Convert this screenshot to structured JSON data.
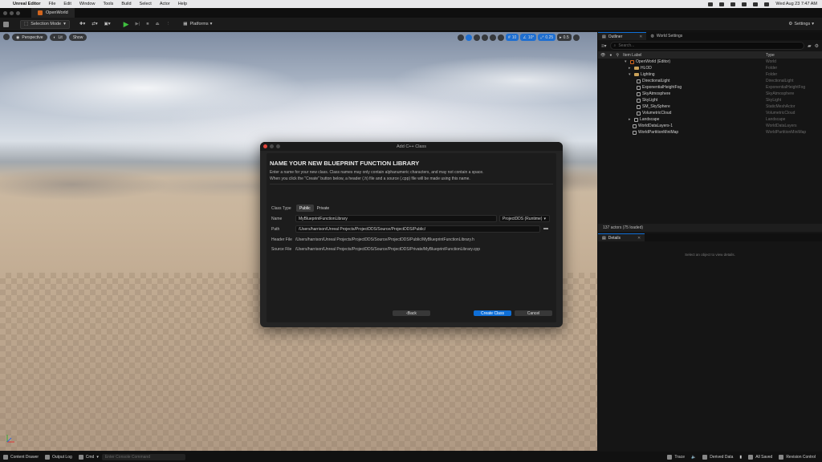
{
  "menubar": {
    "app": "Unreal Editor",
    "items": [
      "File",
      "Edit",
      "Window",
      "Tools",
      "Build",
      "Select",
      "Actor",
      "Help"
    ],
    "clock": "Wed Aug 23  7:47 AM"
  },
  "tab": {
    "title": "OpenWorld"
  },
  "toolbar": {
    "mode": "Selection Mode",
    "platforms": "Platforms",
    "settings": "Settings"
  },
  "viewport": {
    "perspective": "Perspective",
    "lit": "Lit",
    "show": "Show",
    "grid_snap": "10",
    "rot_snap": "10°",
    "scale_snap": "0.25",
    "cam_speed": "0.5"
  },
  "dialog": {
    "window_title": "Add C++ Class",
    "heading": "NAME YOUR NEW BLUEPRINT FUNCTION LIBRARY",
    "desc1": "Enter a name for your new class. Class names may only contain alphanumeric characters, and may not contain a space.",
    "desc2": "When you click the \"Create\" button below, a header (.h) file and a source (.cpp) file will be made using this name.",
    "class_type_label": "Class Type",
    "public": "Public",
    "private": "Private",
    "name_label": "Name",
    "name_value": "MyBlueprintFunctionLibrary",
    "module": "ProjectDDS (Runtime)",
    "path_label": "Path",
    "path_value": "/Users/harrison/Unreal Projects/ProjectDDS/Source/ProjectDDS/Public/",
    "header_label": "Header File",
    "header_value": "/Users/harrison/Unreal Projects/ProjectDDS/Source/ProjectDDS/Public/MyBlueprintFunctionLibrary.h",
    "source_label": "Source File",
    "source_value": "/Users/harrison/Unreal Projects/ProjectDDS/Source/ProjectDDS/Private/MyBlueprintFunctionLibrary.cpp",
    "back": "Back",
    "create": "Create Class",
    "cancel": "Cancel"
  },
  "outliner": {
    "tab": "Outliner",
    "tab2": "World Settings",
    "search_placeholder": "Search...",
    "col_label": "Item Label",
    "col_type": "Type",
    "rows": [
      {
        "label": "OpenWorld (Editor)",
        "type": "World"
      },
      {
        "label": "HLOD",
        "type": "Folder"
      },
      {
        "label": "Lighting",
        "type": "Folder"
      },
      {
        "label": "DirectionalLight",
        "type": "DirectionalLight"
      },
      {
        "label": "ExponentialHeightFog",
        "type": "ExponentialHeightFog"
      },
      {
        "label": "SkyAtmosphere",
        "type": "SkyAtmosphere"
      },
      {
        "label": "SkyLight",
        "type": "SkyLight"
      },
      {
        "label": "SM_SkySphere",
        "type": "StaticMeshActor"
      },
      {
        "label": "VolumetricCloud",
        "type": "VolumetricCloud"
      },
      {
        "label": "Landscape",
        "type": "Landscape"
      },
      {
        "label": "WorldDataLayers-1",
        "type": "WorldDataLayers"
      },
      {
        "label": "WorldPartitionMiniMap",
        "type": "WorldPartitionMiniMap"
      }
    ],
    "footer": "137 actors (75 loaded)"
  },
  "details": {
    "tab": "Details",
    "hint": "Select an object to view details."
  },
  "statusbar": {
    "content_drawer": "Content Drawer",
    "output_log": "Output Log",
    "cmd": "Cmd",
    "console_placeholder": "Enter Console Command",
    "trace": "Trace",
    "derived_data": "Derived Data",
    "all_saved": "All Saved",
    "revision": "Revision Control"
  }
}
